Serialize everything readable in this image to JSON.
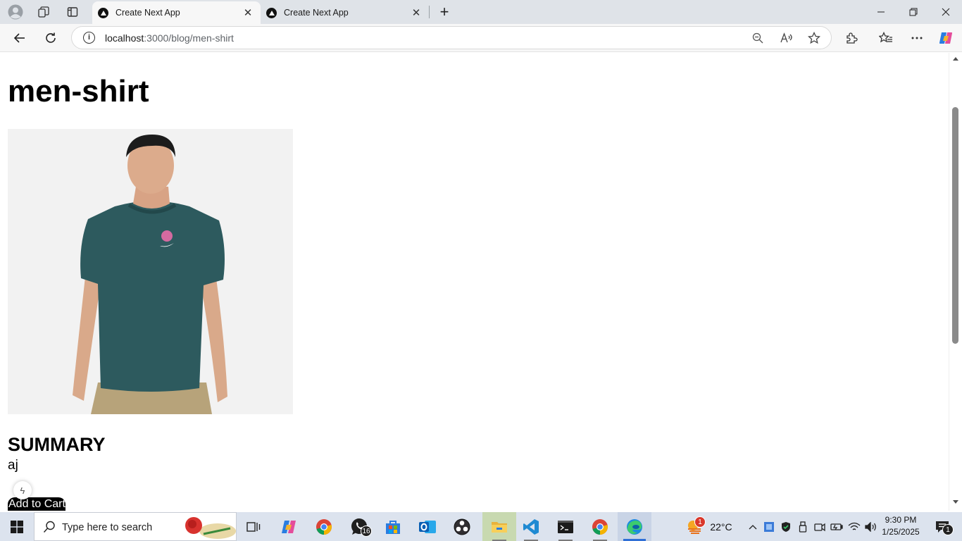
{
  "browser": {
    "tabs": [
      {
        "title": "Create Next App",
        "active": true
      },
      {
        "title": "Create Next App",
        "active": false
      }
    ],
    "address": {
      "host": "localhost",
      "path": ":3000/blog/men-shirt"
    }
  },
  "page": {
    "title": "men-shirt",
    "image_alt": "Model wearing a teal Nike t-shirt",
    "summary_heading": "SUMMARY",
    "summary_text": "aj",
    "add_to_cart_label": "Add to Cart"
  },
  "taskbar": {
    "search_placeholder": "Type here to search",
    "whatsapp_badge": "16",
    "weather_badge": "1",
    "temperature": "22°C",
    "time": "9:30 PM",
    "date": "1/25/2025",
    "notification_count": "1"
  },
  "colors": {
    "tab_strip": "#dfe3e8",
    "toolbar": "#f7f7f7",
    "taskbar": "#dce3ee",
    "shirt": "#2d5a5e",
    "accent": "#2f6fd6"
  }
}
